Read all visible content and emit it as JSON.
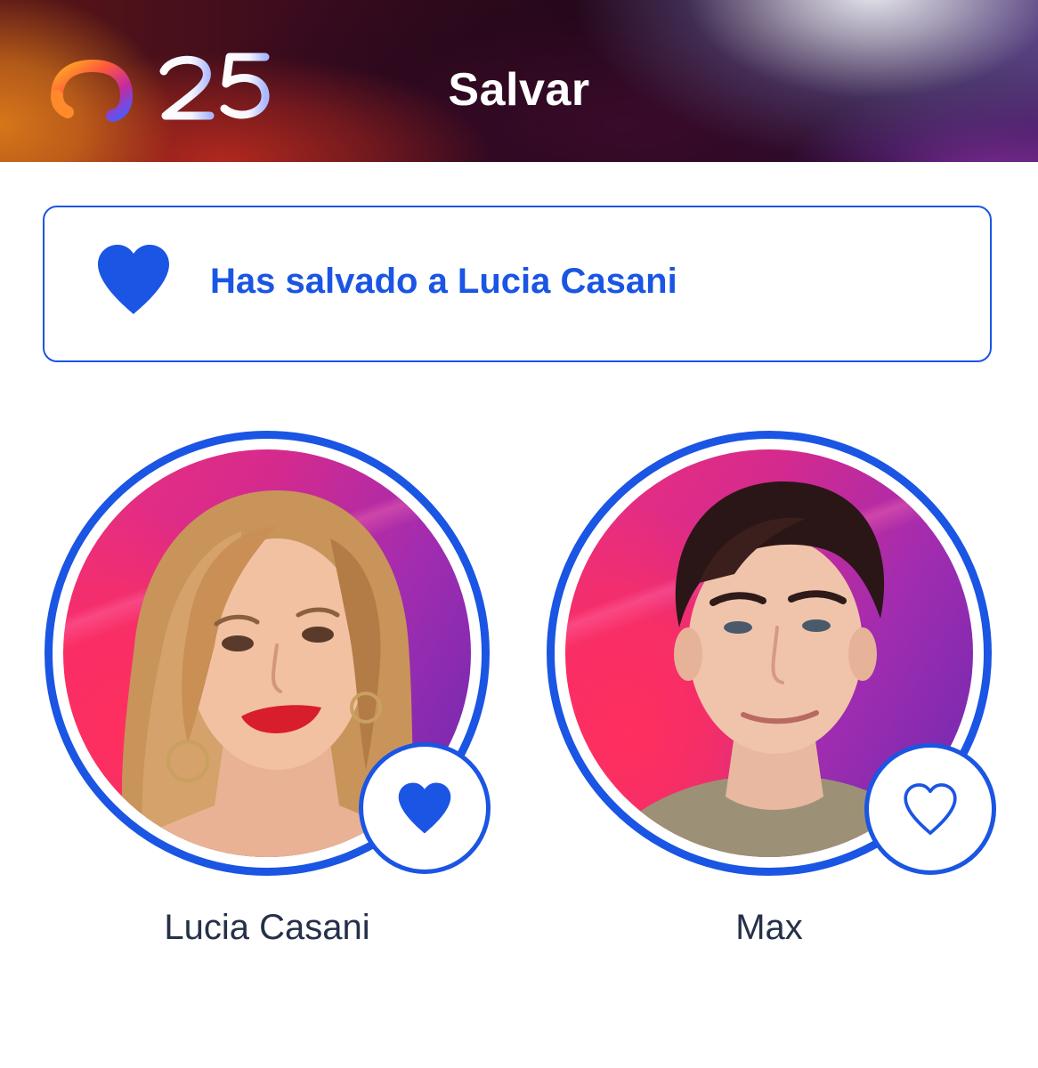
{
  "header": {
    "logo_text": "OT25",
    "title": "Salvar"
  },
  "banner": {
    "icon": "heart-icon",
    "message": "Has salvado a Lucia Casani"
  },
  "contestants": [
    {
      "name": "Lucia Casani",
      "saved": true,
      "badge_icon": "heart-filled-icon"
    },
    {
      "name": "Max",
      "saved": false,
      "badge_icon": "heart-outline-icon"
    }
  ],
  "colors": {
    "accent": "#1a55e3",
    "name_text": "#25304a"
  }
}
